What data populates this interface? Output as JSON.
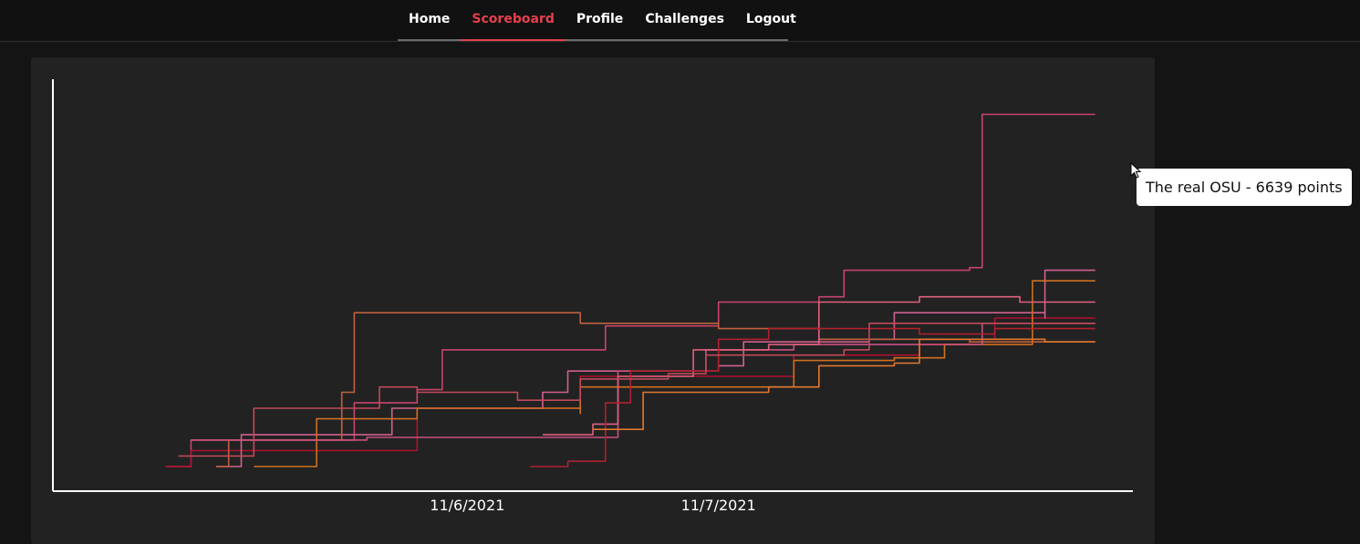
{
  "nav": {
    "items": [
      {
        "label": "Home"
      },
      {
        "label": "Scoreboard",
        "active": true
      },
      {
        "label": "Profile"
      },
      {
        "label": "Challenges"
      },
      {
        "label": "Logout"
      }
    ],
    "accent": "#e5404c"
  },
  "tooltip": {
    "text": "The real OSU - 6639 points"
  },
  "chart_data": {
    "type": "line",
    "title": "",
    "xlabel": "",
    "ylabel": "",
    "x_ticks": [
      "11/6/2021",
      "11/7/2021"
    ],
    "xlim": [
      -1.65,
      2.65
    ],
    "ylim": [
      0,
      7300
    ],
    "grid": false,
    "legend": "none",
    "series": [
      {
        "color": "#c8446e",
        "points": [
          [
            -1.2,
            0
          ],
          [
            -1.1,
            500
          ],
          [
            -0.45,
            800
          ],
          [
            -0.45,
            1200
          ],
          [
            -0.2,
            1450
          ],
          [
            -0.1,
            2200
          ],
          [
            0.55,
            2300
          ],
          [
            0.55,
            2650
          ],
          [
            1.0,
            2700
          ],
          [
            1.0,
            3100
          ],
          [
            1.4,
            3200
          ],
          [
            1.5,
            3700
          ],
          [
            2.0,
            3750
          ],
          [
            2.05,
            6639
          ],
          [
            2.5,
            6639
          ]
        ]
      },
      {
        "color": "#b01030",
        "points": [
          [
            -1.2,
            0
          ],
          [
            -1.1,
            300
          ],
          [
            -0.2,
            800
          ],
          [
            -0.2,
            1100
          ],
          [
            0.45,
            1300
          ],
          [
            0.45,
            1700
          ],
          [
            1.3,
            1800
          ],
          [
            1.3,
            2100
          ],
          [
            1.8,
            2300
          ],
          [
            2.0,
            2400
          ],
          [
            2.1,
            2800
          ],
          [
            2.5,
            2800
          ]
        ]
      },
      {
        "color": "#d06090",
        "points": [
          [
            -1.0,
            0
          ],
          [
            -0.9,
            600
          ],
          [
            -0.3,
            750
          ],
          [
            -0.3,
            1100
          ],
          [
            0.3,
            1400
          ],
          [
            0.4,
            1800
          ],
          [
            1.0,
            1900
          ],
          [
            1.1,
            2350
          ],
          [
            1.6,
            2400
          ],
          [
            1.7,
            2900
          ],
          [
            2.3,
            2800
          ],
          [
            2.3,
            3700
          ],
          [
            2.5,
            3700
          ]
        ]
      },
      {
        "color": "#c06040",
        "points": [
          [
            -1.0,
            0
          ],
          [
            -0.95,
            500
          ],
          [
            -0.5,
            1400
          ],
          [
            -0.45,
            2900
          ],
          [
            -0.1,
            2900
          ],
          [
            0.45,
            2700
          ],
          [
            1.0,
            2600
          ],
          [
            1.4,
            2400
          ],
          [
            2.0,
            2350
          ],
          [
            2.5,
            2350
          ]
        ]
      },
      {
        "color": "#d07020",
        "points": [
          [
            -0.85,
            0
          ],
          [
            -0.6,
            900
          ],
          [
            -0.2,
            1100
          ],
          [
            0.45,
            1000
          ],
          [
            0.45,
            1500
          ],
          [
            1.1,
            1500
          ],
          [
            1.3,
            2000
          ],
          [
            1.7,
            2050
          ],
          [
            1.9,
            2300
          ],
          [
            2.2,
            2300
          ],
          [
            2.25,
            3500
          ],
          [
            2.5,
            3500
          ]
        ]
      },
      {
        "color": "#c85080",
        "points": [
          [
            -1.1,
            500
          ],
          [
            -0.4,
            550
          ],
          [
            0.3,
            550
          ],
          [
            0.6,
            1800
          ],
          [
            0.95,
            2200
          ],
          [
            1.3,
            2300
          ],
          [
            1.9,
            2300
          ],
          [
            2.05,
            2700
          ],
          [
            2.5,
            2700
          ]
        ]
      },
      {
        "color": "#e06080",
        "points": [
          [
            0.3,
            600
          ],
          [
            0.5,
            800
          ],
          [
            0.6,
            1700
          ],
          [
            0.9,
            2200
          ],
          [
            1.2,
            2300
          ],
          [
            1.4,
            3100
          ],
          [
            1.8,
            3200
          ],
          [
            2.2,
            3100
          ],
          [
            2.5,
            3100
          ]
        ]
      },
      {
        "color": "#b02030",
        "points": [
          [
            0.25,
            0
          ],
          [
            0.4,
            100
          ],
          [
            0.55,
            1200
          ],
          [
            0.65,
            1800
          ],
          [
            1.0,
            2400
          ],
          [
            1.2,
            2600
          ],
          [
            1.8,
            2500
          ],
          [
            2.1,
            2600
          ],
          [
            2.5,
            2600
          ]
        ]
      },
      {
        "color": "#e07830",
        "points": [
          [
            0.5,
            700
          ],
          [
            0.7,
            1400
          ],
          [
            1.2,
            1500
          ],
          [
            1.4,
            1900
          ],
          [
            1.7,
            1950
          ],
          [
            1.8,
            2400
          ],
          [
            2.3,
            2350
          ],
          [
            2.5,
            2350
          ]
        ]
      },
      {
        "color": "#c04a5a",
        "points": [
          [
            -1.15,
            200
          ],
          [
            -0.85,
            1100
          ],
          [
            -0.35,
            1500
          ],
          [
            -0.2,
            1400
          ],
          [
            0.2,
            1250
          ],
          [
            0.45,
            1650
          ],
          [
            0.8,
            1750
          ],
          [
            0.95,
            2100
          ],
          [
            1.5,
            2200
          ],
          [
            1.6,
            2700
          ],
          [
            2.1,
            2700
          ],
          [
            2.5,
            2700
          ]
        ]
      }
    ]
  }
}
